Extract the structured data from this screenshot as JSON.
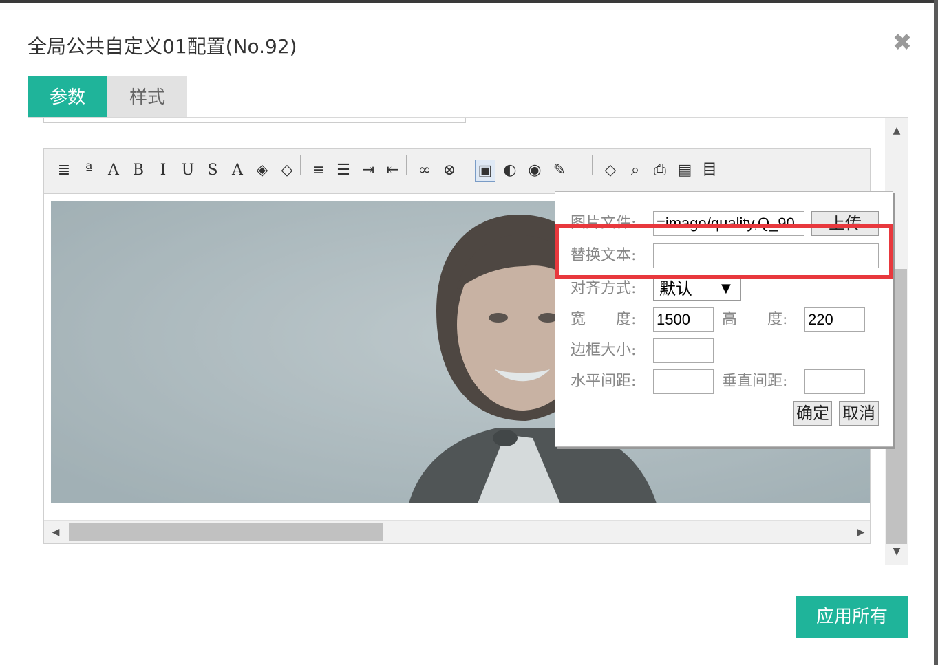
{
  "dialog": {
    "title": "全局公共自定义01配置(No.92)",
    "close_glyph": "✖"
  },
  "tabs": [
    {
      "label": "参数",
      "active": true
    },
    {
      "label": "样式",
      "active": false
    }
  ],
  "toolbar": {
    "buttons": [
      {
        "icon": "paragraph-format-icon",
        "glyph": "≣"
      },
      {
        "icon": "font-family-icon",
        "glyph": "ª"
      },
      {
        "icon": "font-size-icon",
        "glyph": "A"
      },
      {
        "icon": "bold-icon",
        "glyph": "B"
      },
      {
        "icon": "italic-icon",
        "glyph": "I"
      },
      {
        "icon": "underline-icon",
        "glyph": "U"
      },
      {
        "icon": "strikethrough-icon",
        "glyph": "S"
      },
      {
        "icon": "font-color-icon",
        "glyph": "A"
      },
      {
        "icon": "highlight-color-icon",
        "glyph": "◈"
      },
      {
        "icon": "eraser-icon",
        "glyph": "◇"
      },
      {
        "icon": "align-icon",
        "glyph": "≡"
      },
      {
        "icon": "list-icon",
        "glyph": "☰"
      },
      {
        "icon": "indent-icon",
        "glyph": "⇥"
      },
      {
        "icon": "outdent-icon",
        "glyph": "⇤"
      },
      {
        "icon": "link-icon",
        "glyph": "∞"
      },
      {
        "icon": "unlink-icon",
        "glyph": "⊗"
      },
      {
        "icon": "image-icon",
        "glyph": "▣"
      },
      {
        "icon": "flash-icon",
        "glyph": "◐"
      },
      {
        "icon": "media-icon",
        "glyph": "◉"
      },
      {
        "icon": "table-icon",
        "glyph": "✎"
      },
      {
        "icon": "source-code-icon",
        "glyph": "◇"
      },
      {
        "icon": "preview-icon",
        "glyph": "⌕"
      },
      {
        "icon": "print-icon",
        "glyph": "⎙"
      },
      {
        "icon": "fullscreen-icon",
        "glyph": "▤"
      },
      {
        "icon": "template-icon",
        "glyph": "目"
      }
    ]
  },
  "image_dialog": {
    "file_label": "图片文件:",
    "file_value": "=image/quality,Q_90",
    "upload_label": "上传",
    "alt_label": "替换文本:",
    "alt_value": "",
    "align_label": "对齐方式:",
    "align_value": "默认",
    "width_label": "宽　　度:",
    "width_value": "1500",
    "height_label": "高　　度:",
    "height_value": "220",
    "border_label": "边框大小:",
    "border_value": "",
    "hspace_label": "水平间距:",
    "hspace_value": "",
    "vspace_label": "垂直间距:",
    "vspace_value": "",
    "ok_label": "确定",
    "cancel_label": "取消"
  },
  "footer": {
    "apply_label": "应用所有"
  },
  "colors": {
    "accent": "#1fb49a",
    "highlight": "#e8383d"
  }
}
